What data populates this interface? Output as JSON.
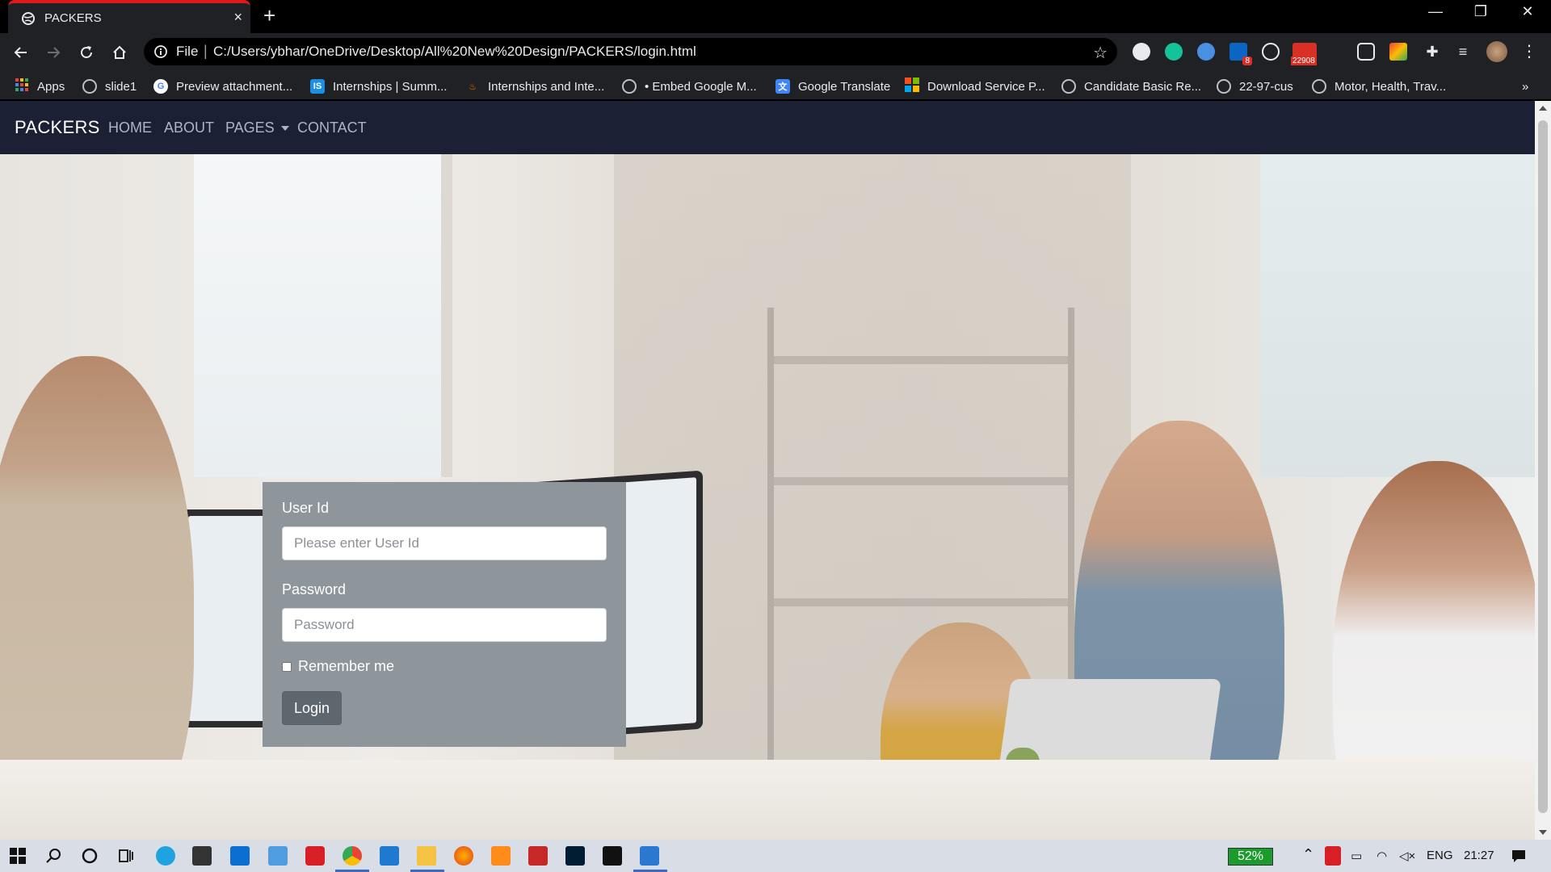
{
  "browser": {
    "tab_title": "PACKERS",
    "tab_close": "×",
    "new_tab": "+",
    "window_controls": {
      "minimize": "—",
      "restore": "❐",
      "close": "✕"
    },
    "omnibox": {
      "scheme_label": "File",
      "separator": "|",
      "url": "C:/Users/ybhar/OneDrive/Desktop/All%20New%20Design/PACKERS/login.html"
    },
    "extensions": [
      {
        "name": "circle-ext-icon",
        "color": "#e8eaed"
      },
      {
        "name": "grammarly-icon",
        "color": "#15c39a"
      },
      {
        "name": "eye-ext-icon",
        "color": "#4a90e2"
      },
      {
        "name": "linkedin-ext-icon",
        "color": "#0a66c2",
        "badge": "8"
      },
      {
        "name": "speedometer-ext-icon",
        "color": "#e8eaed"
      },
      {
        "name": "mail-ext-icon",
        "color": "#d93025",
        "badge": "22908"
      },
      {
        "name": "camera-ext-icon",
        "color": "#e8eaed"
      },
      {
        "name": "colorful-ext-icon",
        "color": "#f4b400"
      },
      {
        "name": "puzzle-icon",
        "color": "#e8eaed"
      },
      {
        "name": "reading-list-icon",
        "color": "#e8eaed"
      }
    ]
  },
  "bookmarks": [
    {
      "label": "Apps",
      "icon": "apps-grid-icon"
    },
    {
      "label": "slide1",
      "icon": "globe-icon"
    },
    {
      "label": "Preview attachment...",
      "icon": "google-icon"
    },
    {
      "label": "Internships | Summ...",
      "icon": "internshala-icon"
    },
    {
      "label": "Internships and Inte...",
      "icon": "fire-icon"
    },
    {
      "label": "• Embed Google M...",
      "icon": "globe-icon"
    },
    {
      "label": "Google Translate",
      "icon": "translate-icon"
    },
    {
      "label": "Download Service P...",
      "icon": "microsoft-icon"
    },
    {
      "label": "Candidate Basic Re...",
      "icon": "globe-icon"
    },
    {
      "label": "22-97-cus",
      "icon": "globe-icon"
    },
    {
      "label": "Motor, Health, Trav...",
      "icon": "globe-icon"
    }
  ],
  "bookmarks_overflow": "»",
  "site": {
    "brand": "PACKERS",
    "nav": [
      "HOME",
      "ABOUT",
      "PAGES",
      "CONTACT"
    ]
  },
  "login": {
    "user_label": "User Id",
    "user_placeholder": "Please enter User Id",
    "user_value": "",
    "password_label": "Password",
    "password_placeholder": "Password",
    "password_value": "",
    "remember_label": "Remember me",
    "remember_checked": false,
    "submit_label": "Login"
  },
  "taskbar": {
    "apps": [
      "windows-start-icon",
      "search-icon",
      "cortana-icon",
      "task-view-icon",
      "edge-icon",
      "store-icon",
      "mail-icon",
      "people-icon",
      "anydesk-icon",
      "chrome-icon",
      "vscode-icon",
      "file-explorer-icon",
      "firefox-icon",
      "sublime-icon",
      "filezilla-icon",
      "photoshop-icon",
      "netflix-icon",
      "photos-icon"
    ],
    "battery_percent": "52%",
    "language": "ENG",
    "time": "21:27"
  },
  "colors": {
    "tab_accent": "#e01a1a",
    "site_navbar": "#1b2034",
    "login_card": "#8e959b",
    "login_button": "#5f676e",
    "battery": "#1b9b2c"
  }
}
